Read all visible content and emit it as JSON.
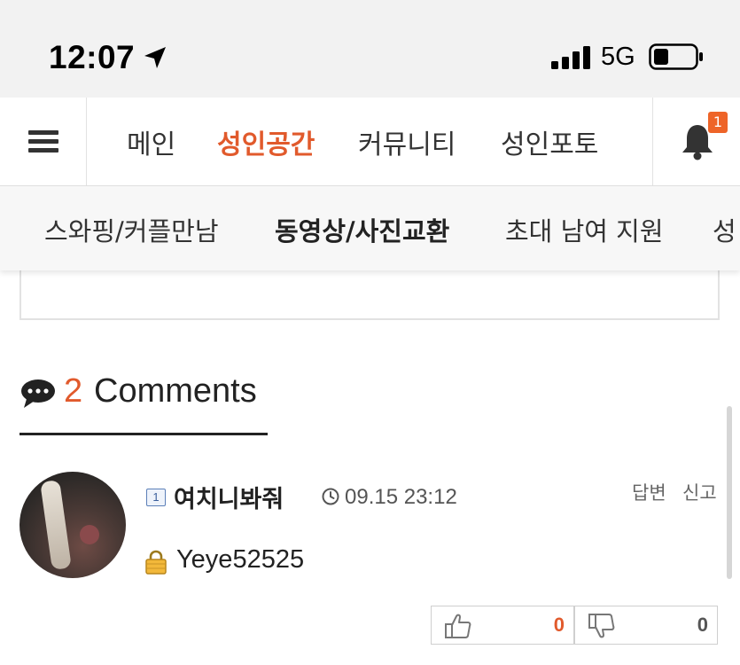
{
  "status_bar": {
    "time": "12:07",
    "network": "5G",
    "icons": [
      "location-arrow-icon",
      "signal-bars-icon",
      "battery-icon"
    ]
  },
  "main_nav": {
    "items": [
      {
        "label": "메인",
        "active": false
      },
      {
        "label": "성인공간",
        "active": true
      },
      {
        "label": "커뮤니티",
        "active": false
      },
      {
        "label": "성인포토",
        "active": false
      }
    ],
    "notification_count": "1",
    "accent_color": "#e15a2c"
  },
  "sub_nav": {
    "items": [
      {
        "label": "스와핑/커플만남",
        "active": false
      },
      {
        "label": "동영상/사진교환",
        "active": true
      },
      {
        "label": "초대 남여 지원",
        "active": false
      },
      {
        "label": "성",
        "active": false
      }
    ]
  },
  "comments": {
    "count": "2",
    "label": "Comments",
    "items": [
      {
        "level": "1",
        "author": "여치니봐줘",
        "timestamp": "09.15 23:12",
        "reply_label": "답변",
        "report_label": "신고",
        "text": "Yeye52525",
        "locked": true,
        "upvotes": "0",
        "downvotes": "0"
      }
    ]
  }
}
